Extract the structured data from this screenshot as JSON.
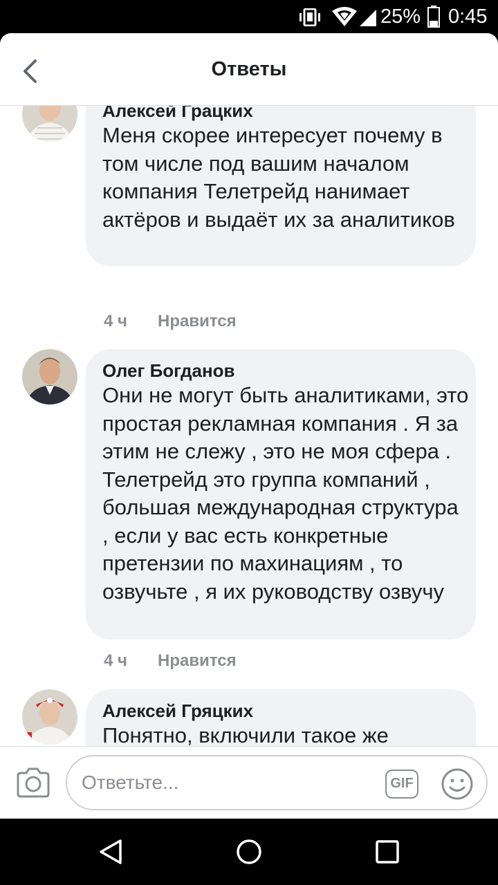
{
  "status_bar": {
    "battery": "25%",
    "time": "0:45"
  },
  "header": {
    "title": "Ответы"
  },
  "comments": [
    {
      "author": "Алексей Грацких",
      "text": "Меня скорее интересует почему в том числе под вашим началом компания Телетрейд нанимает актёров и выдаёт их за аналитиков",
      "time": "4 ч",
      "like": "Нравится"
    },
    {
      "author": "Олег Богданов",
      "text": "Они не могут быть аналитиками, это простая рекламная компания . Я за этим не слежу , это не моя сфера . Телетрейд это группа компаний , большая международная структура , если у вас есть конкретные претензии по махинациям , то озвучьте , я их руководству озвучу",
      "time": "4 ч",
      "like": "Нравится"
    },
    {
      "author": "Алексей Гряцких",
      "text": "Понятно, включили такое же блеяние, как и Ярмольник. Актёр"
    }
  ],
  "composer": {
    "placeholder": "Ответьте...",
    "gif_label": "GIF"
  }
}
